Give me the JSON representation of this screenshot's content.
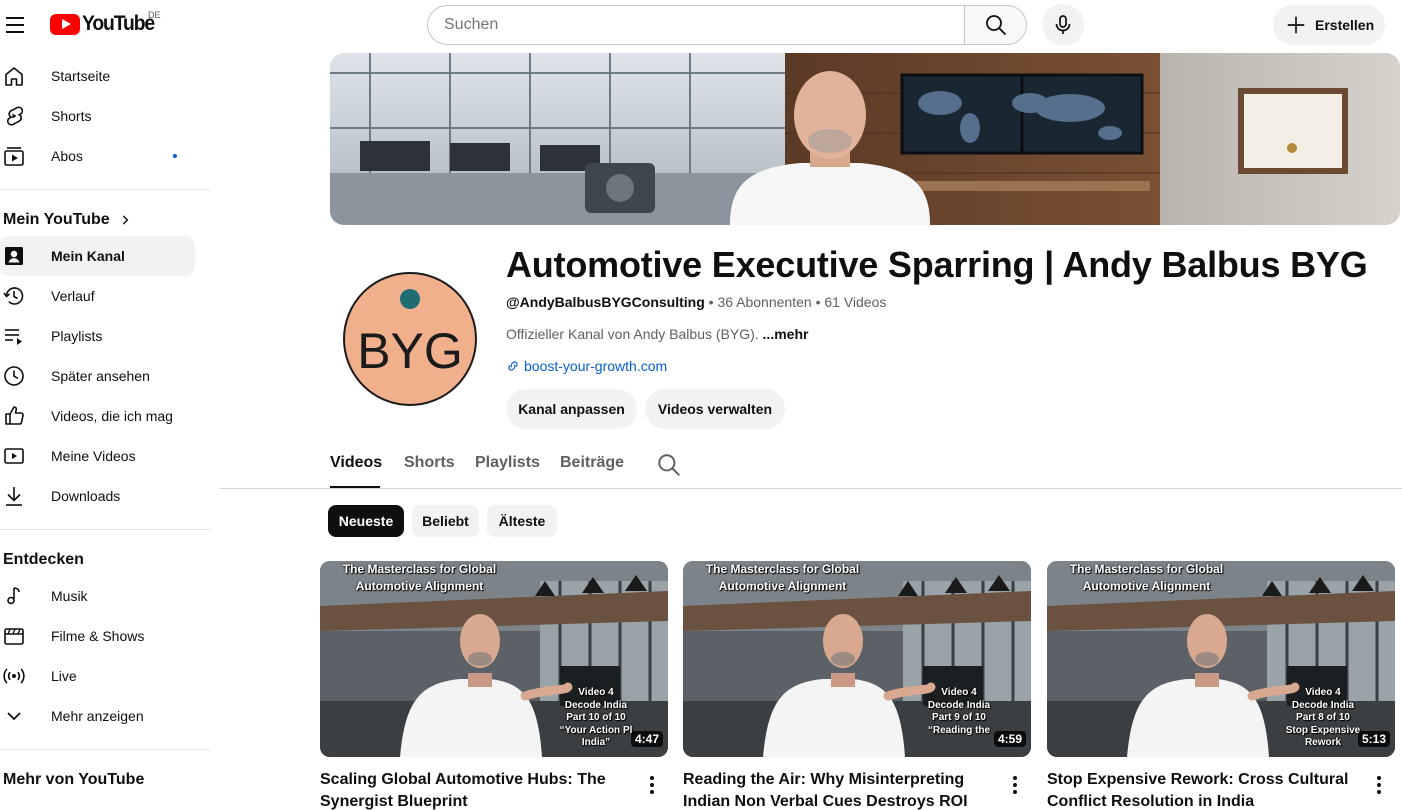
{
  "header": {
    "logo_text": "YouTube",
    "region": "DE",
    "search_placeholder": "Suchen",
    "create_label": "Erstellen"
  },
  "sidebar": {
    "primary": [
      {
        "label": "Startseite",
        "icon": "home-icon"
      },
      {
        "label": "Shorts",
        "icon": "shorts-icon"
      },
      {
        "label": "Abos",
        "icon": "subscriptions-icon"
      }
    ],
    "you_heading": "Mein YouTube",
    "you_items": [
      {
        "label": "Mein Kanal",
        "icon": "your-channel-icon",
        "active": true
      },
      {
        "label": "Verlauf",
        "icon": "history-icon"
      },
      {
        "label": "Playlists",
        "icon": "playlists-icon"
      },
      {
        "label": "Später ansehen",
        "icon": "watch-later-icon"
      },
      {
        "label": "Videos, die ich mag",
        "icon": "thumbs-up-icon"
      },
      {
        "label": "Meine Videos",
        "icon": "your-videos-icon"
      },
      {
        "label": "Downloads",
        "icon": "download-icon"
      }
    ],
    "explore_heading": "Entdecken",
    "explore_items": [
      {
        "label": "Musik",
        "icon": "music-icon"
      },
      {
        "label": "Filme & Shows",
        "icon": "movies-icon"
      },
      {
        "label": "Live",
        "icon": "live-icon"
      },
      {
        "label": "Mehr anzeigen",
        "icon": "chevron-down-icon"
      }
    ],
    "more_heading": "Mehr von YouTube"
  },
  "channel": {
    "title": "Automotive Executive Sparring | Andy Balbus BYG",
    "handle": "@AndyBalbusBYGConsulting",
    "subscribers": "36 Abonnenten",
    "video_count": "61 Videos",
    "description": "Offizieller Kanal von Andy Balbus (BYG).",
    "more": "...mehr",
    "link": "boost-your-growth.com",
    "avatar_text": "BYG",
    "customize_label": "Kanal anpassen",
    "manage_label": "Videos verwalten"
  },
  "tabs": [
    {
      "label": "Videos",
      "active": true
    },
    {
      "label": "Shorts"
    },
    {
      "label": "Playlists"
    },
    {
      "label": "Beiträge"
    }
  ],
  "chips": [
    {
      "label": "Neueste",
      "active": true
    },
    {
      "label": "Beliebt"
    },
    {
      "label": "Älteste"
    }
  ],
  "videos": [
    {
      "title": "Scaling Global Automotive Hubs: The Synergist Blueprint",
      "duration": "4:47",
      "thumb_headline": "The Masterclass for Global Automotive Alignment",
      "thumb_series": "Video 4\nDecode India\nPart 10 of 10\n“Your Action Pl\nIndia”"
    },
    {
      "title": "Reading the Air: Why Misinterpreting Indian Non Verbal Cues Destroys ROI",
      "duration": "4:59",
      "thumb_headline": "The Masterclass for Global Automotive Alignment",
      "thumb_series": "Video 4\nDecode India\nPart 9 of 10\n“Reading the"
    },
    {
      "title": "Stop Expensive Rework: Cross Cultural Conflict Resolution in India",
      "duration": "5:13",
      "thumb_headline": "The Masterclass for Global Automotive Alignment",
      "thumb_series": "Video 4\nDecode India\nPart 8 of 10\nStop Expensive\nRework"
    }
  ]
}
